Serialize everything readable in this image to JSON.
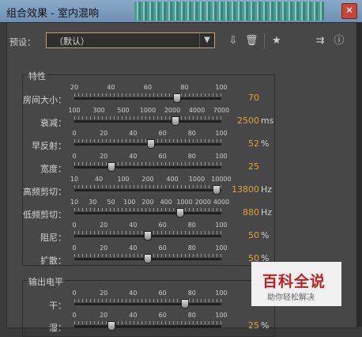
{
  "window": {
    "title": "组合效果 - 室内混响",
    "close_glyph": "✕"
  },
  "toolbar": {
    "preset_label": "预设：",
    "preset_value": "（默认）",
    "icons": [
      "save-preset-icon",
      "delete-preset-icon",
      "favorite-star-icon",
      "routing-icon",
      "info-icon"
    ]
  },
  "characteristics": {
    "title": "特性",
    "rows": [
      {
        "label": "房间大小：",
        "scale": [
          "20",
          "40",
          "60",
          "80",
          "100"
        ],
        "value": "70",
        "unit": "",
        "level": 0.7
      },
      {
        "label": "衰减：",
        "scale": [
          "100",
          "300",
          "500",
          "1000",
          "2000",
          "4000",
          "7000"
        ],
        "value": "2500",
        "unit": "ms",
        "level": 0.69
      },
      {
        "label": "早反射：",
        "scale": [
          "0",
          "20",
          "40",
          "60",
          "80",
          "100"
        ],
        "value": "52",
        "unit": "%",
        "level": 0.52
      },
      {
        "label": "宽度：",
        "scale": [
          "0",
          "20",
          "40",
          "60",
          "80",
          "100"
        ],
        "value": "25",
        "unit": "",
        "level": 0.25
      },
      {
        "label": "高频剪切：",
        "scale": [
          "10",
          "40",
          "100",
          "200",
          "400",
          "1000",
          "10000"
        ],
        "value": "13800",
        "unit": "Hz",
        "level": 0.97
      },
      {
        "label": "低频剪切：",
        "scale": [
          "10",
          "30",
          "50",
          "100",
          "200",
          "400",
          "1000",
          "2000",
          "4000"
        ],
        "value": "880",
        "unit": "Hz",
        "level": 0.72
      },
      {
        "label": "阻尼：",
        "scale": [
          "0",
          "20",
          "40",
          "60",
          "80",
          "100"
        ],
        "value": "50",
        "unit": "%",
        "level": 0.5
      },
      {
        "label": "扩散：",
        "scale": [
          "0",
          "20",
          "40",
          "60",
          "80",
          "100"
        ],
        "value": "50",
        "unit": "%",
        "level": 0.5
      }
    ]
  },
  "output": {
    "title": "输出电平",
    "rows": [
      {
        "label": "干：",
        "scale": [
          "0",
          "20",
          "40",
          "60",
          "80",
          "100"
        ],
        "value": "",
        "unit": "",
        "level": 0.75
      },
      {
        "label": "湿：",
        "scale": [
          "0",
          "20",
          "40",
          "60",
          "80",
          "100"
        ],
        "value": "25",
        "unit": "%",
        "level": 0.25
      }
    ]
  },
  "watermark": {
    "big": "百科全说",
    "small": "助你轻松解决"
  }
}
